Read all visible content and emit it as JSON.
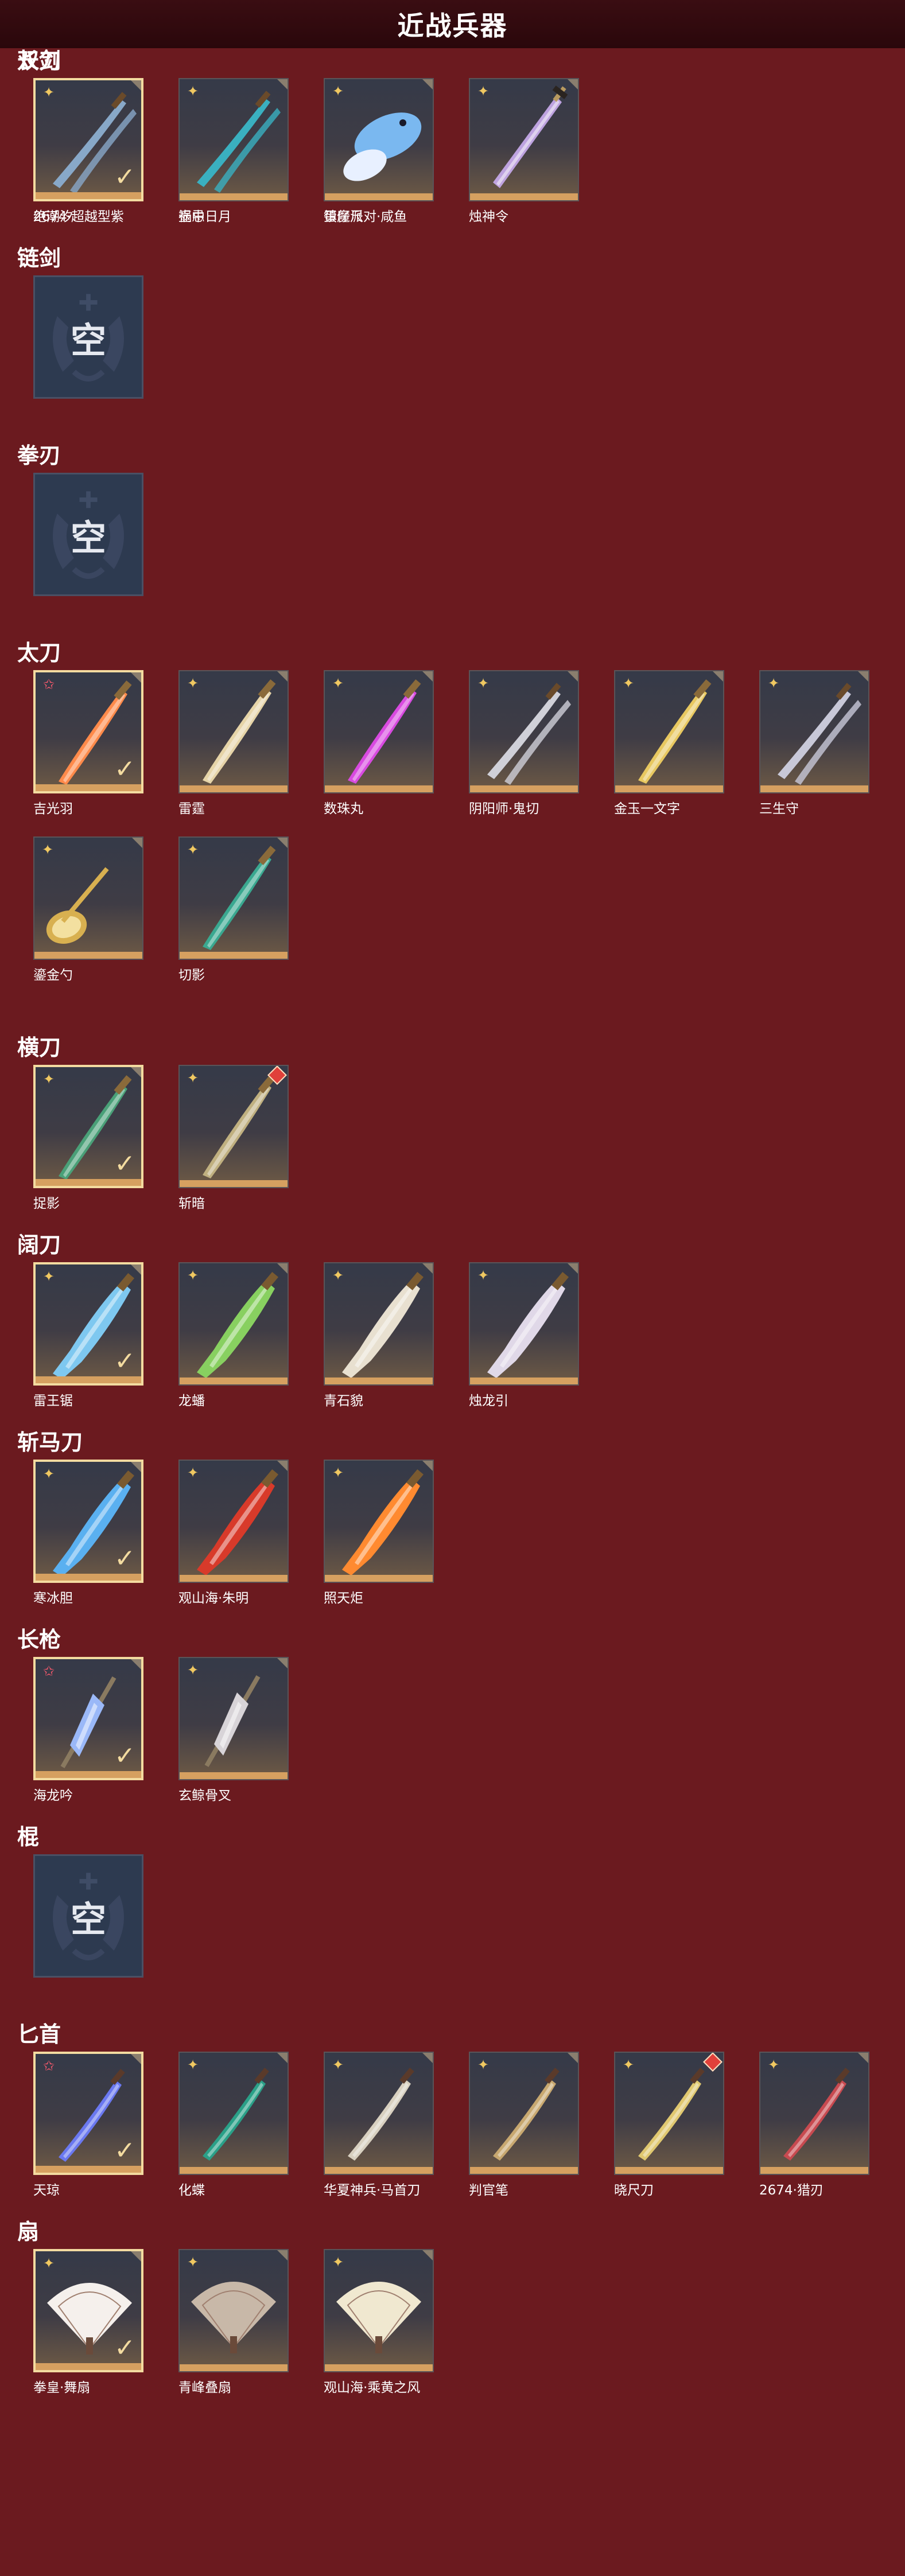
{
  "header": {
    "title": "近战兵器"
  },
  "categories": [
    {
      "name": "长剑",
      "items": [
        {
          "name": "2674·超越型紫",
          "rarity": "rainbow",
          "selected": true,
          "weapon_color": "#7fb2ff",
          "weapon_shape": "sword"
        },
        {
          "name": "壶中日月",
          "rarity": "gold",
          "selected": false,
          "weapon_color": "#6ee0d4",
          "weapon_shape": "sword"
        },
        {
          "name": "镇魔尺",
          "rarity": "gold",
          "selected": false,
          "weapon_color": "#c8b484",
          "weapon_shape": "sword"
        },
        {
          "name": "烛神令",
          "rarity": "gold",
          "selected": false,
          "weapon_color": "#c4a8e8",
          "weapon_shape": "sword"
        }
      ]
    },
    {
      "name": "链剑",
      "items": [
        {
          "name": "",
          "empty": true,
          "empty_label": "空"
        }
      ]
    },
    {
      "name": "拳刃",
      "items": [
        {
          "name": "",
          "empty": true,
          "empty_label": "空"
        }
      ]
    },
    {
      "name": "太刀",
      "items": [
        {
          "name": "吉光羽",
          "rarity": "red",
          "selected": true,
          "weapon_color": "#ff8a4a",
          "weapon_shape": "blade"
        },
        {
          "name": "雷霆",
          "rarity": "gold",
          "selected": false,
          "weapon_color": "#e6d4a8",
          "weapon_shape": "blade"
        },
        {
          "name": "数珠丸",
          "rarity": "gold",
          "selected": false,
          "weapon_color": "#d84ae0",
          "weapon_shape": "blade"
        },
        {
          "name": "阴阳师·鬼切",
          "rarity": "gold",
          "selected": false,
          "weapon_color": "#d0d0d8",
          "weapon_shape": "twin"
        },
        {
          "name": "金玉一文字",
          "rarity": "gold",
          "selected": false,
          "weapon_color": "#e8c860",
          "weapon_shape": "blade"
        },
        {
          "name": "三生守",
          "rarity": "gold",
          "selected": false,
          "weapon_color": "#c8c8d8",
          "weapon_shape": "twin"
        },
        {
          "name": "鎏金勺",
          "rarity": "gold",
          "selected": false,
          "weapon_color": "#d8b050",
          "weapon_shape": "spoon"
        },
        {
          "name": "切影",
          "rarity": "gold",
          "selected": false,
          "weapon_color": "#3aa890",
          "weapon_shape": "blade"
        }
      ]
    },
    {
      "name": "横刀",
      "items": [
        {
          "name": "捉影",
          "rarity": "gold",
          "selected": true,
          "weapon_color": "#4aa078",
          "weapon_shape": "blade"
        },
        {
          "name": "斩暗",
          "rarity": "red-badge",
          "selected": false,
          "weapon_color": "#c0b080",
          "weapon_shape": "blade"
        }
      ]
    },
    {
      "name": "阔刀",
      "items": [
        {
          "name": "雷王锯",
          "rarity": "gold",
          "selected": true,
          "weapon_color": "#7ec8f0",
          "weapon_shape": "broad"
        },
        {
          "name": "龙蟠",
          "rarity": "gold",
          "selected": false,
          "weapon_color": "#88d060",
          "weapon_shape": "broad"
        },
        {
          "name": "青石貌",
          "rarity": "gold",
          "selected": false,
          "weapon_color": "#e8e0d0",
          "weapon_shape": "broad"
        },
        {
          "name": "烛龙引",
          "rarity": "gold",
          "selected": false,
          "weapon_color": "#e0d8e8",
          "weapon_shape": "broad"
        }
      ]
    },
    {
      "name": "斩马刀",
      "items": [
        {
          "name": "寒冰胆",
          "rarity": "gold",
          "selected": true,
          "weapon_color": "#5ab0f0",
          "weapon_shape": "broad"
        },
        {
          "name": "观山海·朱明",
          "rarity": "gold",
          "selected": false,
          "weapon_color": "#d83a2a",
          "weapon_shape": "broad"
        },
        {
          "name": "照天炬",
          "rarity": "gold",
          "selected": false,
          "weapon_color": "#ff8a30",
          "weapon_shape": "broad"
        }
      ]
    },
    {
      "name": "长枪",
      "items": [
        {
          "name": "海龙吟",
          "rarity": "red",
          "selected": true,
          "weapon_color": "#9ab8f8",
          "weapon_shape": "spear"
        },
        {
          "name": "玄鲸骨叉",
          "rarity": "gold",
          "selected": false,
          "weapon_color": "#d8d4d8",
          "weapon_shape": "spear"
        }
      ]
    },
    {
      "name": "棍",
      "items": [
        {
          "name": "",
          "empty": true,
          "empty_label": "空"
        }
      ]
    },
    {
      "name": "匕首",
      "items": [
        {
          "name": "天琼",
          "rarity": "red",
          "selected": true,
          "weapon_color": "#6a78f0",
          "weapon_shape": "dagger"
        },
        {
          "name": "化蝶",
          "rarity": "gold",
          "selected": false,
          "weapon_color": "#2aa088",
          "weapon_shape": "dagger"
        },
        {
          "name": "华夏神兵·马首刀",
          "rarity": "gold",
          "selected": false,
          "weapon_color": "#d8d0c0",
          "weapon_shape": "dagger"
        },
        {
          "name": "判官笔",
          "rarity": "gold",
          "selected": false,
          "weapon_color": "#c8a870",
          "weapon_shape": "dagger"
        },
        {
          "name": "晓尺刀",
          "rarity": "red-badge",
          "selected": false,
          "weapon_color": "#e0c870",
          "weapon_shape": "dagger"
        },
        {
          "name": "2674·猎刃",
          "rarity": "gold",
          "selected": false,
          "weapon_color": "#c84a50",
          "weapon_shape": "dagger"
        }
      ]
    },
    {
      "name": "扇",
      "items": [
        {
          "name": "拳皇·舞扇",
          "rarity": "gold",
          "selected": true,
          "weapon_color": "#f5f0ec",
          "weapon_shape": "fan"
        },
        {
          "name": "青峰叠扇",
          "rarity": "gold",
          "selected": false,
          "weapon_color": "#c8b8a8",
          "weapon_shape": "fan"
        },
        {
          "name": "观山海·乘黄之风",
          "rarity": "gold",
          "selected": false,
          "weapon_color": "#f0e8d0",
          "weapon_shape": "fan"
        }
      ]
    },
    {
      "name": "双刀",
      "items": [
        {
          "name": "绝潮汐",
          "rarity": "gold",
          "selected": true,
          "weapon_color": "#88a8c8",
          "weapon_shape": "twin"
        },
        {
          "name": "祸忌",
          "rarity": "gold",
          "selected": false,
          "weapon_color": "#3ab0c0",
          "weapon_shape": "twin"
        },
        {
          "name": "蛋仔派对·咸鱼",
          "rarity": "gold",
          "selected": false,
          "weapon_color": "#7ab8f0",
          "weapon_shape": "fish"
        }
      ]
    }
  ]
}
